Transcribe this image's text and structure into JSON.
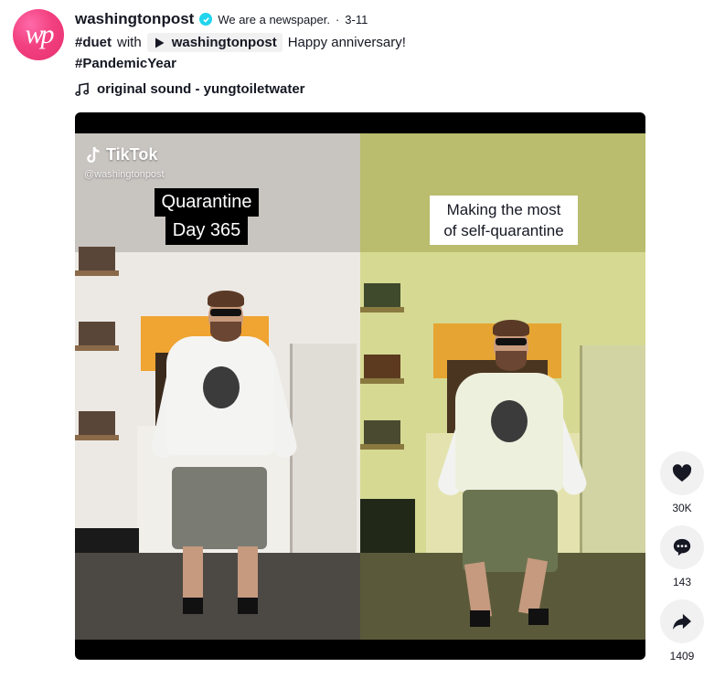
{
  "author": {
    "avatar_icon": "washington-post-logo-icon",
    "username": "washingtonpost",
    "nickname": "We are a newspaper.",
    "separator": "·",
    "date": "3-11",
    "verified_color": "#20d5ec"
  },
  "caption": {
    "hashtag1": "#duet",
    "with_text": "with",
    "mention_user": "washingtonpost",
    "text": "Happy anniversary!",
    "hashtag2": "#PandemicYear"
  },
  "music": {
    "icon": "music-note-icon",
    "title": "original sound - yungtoiletwater"
  },
  "video": {
    "watermark_brand": "TikTok",
    "watermark_handle": "@washingtonpost",
    "left_overlay_line1": "Quarantine",
    "left_overlay_line2": "Day 365",
    "right_overlay_line1": "Making the most",
    "right_overlay_line2": "of self-quarantine"
  },
  "actions": {
    "like_icon": "heart-icon",
    "like_count": "30K",
    "comment_icon": "comment-icon",
    "comment_count": "143",
    "share_icon": "share-icon",
    "share_count": "1409"
  }
}
